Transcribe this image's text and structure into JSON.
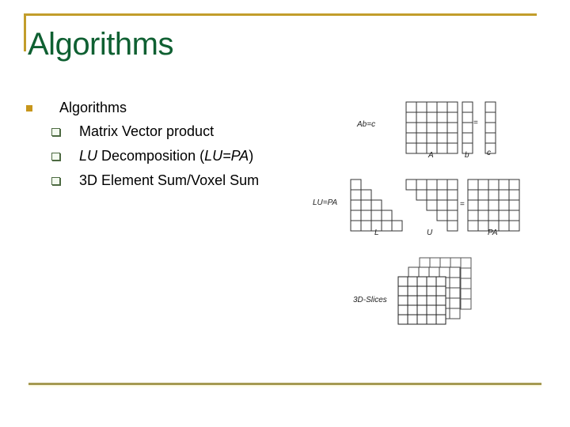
{
  "slide": {
    "title": "Algorithms",
    "colors": {
      "title": "#0f6032",
      "accent": "#c29d2b",
      "footer": "#a59a52",
      "bullet": "#c7961b"
    }
  },
  "content": {
    "bullet": "Algorithms",
    "subitems": [
      {
        "parts": [
          {
            "text": "Matrix Vector product",
            "italic": false
          }
        ]
      },
      {
        "parts": [
          {
            "text": "LU",
            "italic": true
          },
          {
            "text": " Decomposition (",
            "italic": false
          },
          {
            "text": "LU=PA",
            "italic": true
          },
          {
            "text": ")",
            "italic": false
          }
        ]
      },
      {
        "parts": [
          {
            "text": "3D Element Sum/Voxel Sum",
            "italic": false
          }
        ]
      }
    ]
  },
  "figure": {
    "matvec": {
      "label": "Ab=c",
      "eq": "=",
      "names": [
        "A",
        "b",
        "c"
      ]
    },
    "lu": {
      "label": "LU=PA",
      "eq": "=",
      "names": [
        "L",
        "U",
        "PA"
      ]
    },
    "slices": {
      "label": "3D-Slices"
    }
  }
}
